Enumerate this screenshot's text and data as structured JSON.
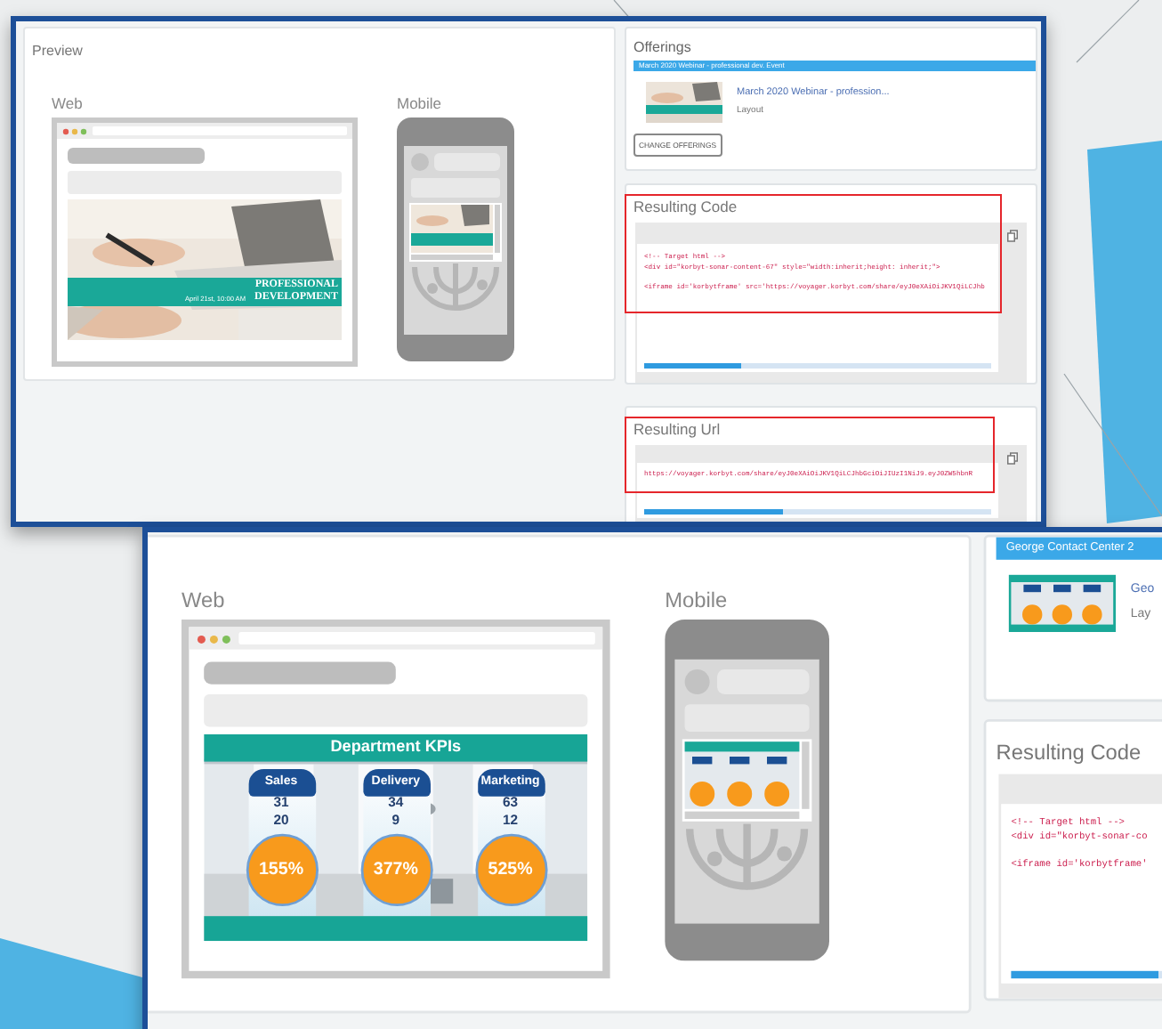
{
  "screenshots": [
    {
      "preview": {
        "title": "Preview",
        "web_label": "Web",
        "mobile_label": "Mobile",
        "web_content": {
          "kind": "banner",
          "headline": [
            "PROFESSIONAL",
            "DEVELOPMENT"
          ],
          "date": "April 21st, 10:00 AM"
        }
      },
      "offerings": {
        "title": "Offerings",
        "dropdown": "March 2020 Webinar - professional dev. Event",
        "item_title": "March 2020 Webinar - profession...",
        "item_subtitle": "Layout",
        "button": "CHANGE OFFERINGS"
      },
      "resulting_code": {
        "title": "Resulting Code",
        "highlighted": true,
        "lines": [
          "<!-- Target html -->",
          "<div id=\"korbyt-sonar-content-67\" style=\"width:inherit;height: inherit;\">",
          "<iframe id='korbytframe' src='https://voyager.korbyt.com/share/eyJ0eXAiOiJKV1QiLCJhb"
        ]
      },
      "resulting_url": {
        "title": "Resulting Url",
        "highlighted": true,
        "value": "https://voyager.korbyt.com/share/eyJ0eXAiOiJKV1QiLCJhbGciOiJIUzI1NiJ9.eyJ0ZW5hbnR"
      }
    },
    {
      "preview": {
        "web_label": "Web",
        "mobile_label": "Mobile",
        "web_content": {
          "kind": "kpi",
          "title": "Department KPIs",
          "cards": [
            {
              "name": "Sales",
              "values": [
                "31",
                "20"
              ],
              "percent": "155%"
            },
            {
              "name": "Delivery",
              "values": [
                "34",
                "9"
              ],
              "percent": "377%"
            },
            {
              "name": "Marketing",
              "values": [
                "63",
                "12"
              ],
              "percent": "525%"
            }
          ]
        }
      },
      "offerings": {
        "dropdown": "George Contact Center 2",
        "item_title": "Geo",
        "item_subtitle": "Lay"
      },
      "resulting_code": {
        "title": "Resulting Code",
        "highlighted": false,
        "lines": [
          "<!-- Target html -->",
          "<div id=\"korbyt-sonar-co",
          "<iframe id='korbytframe'"
        ]
      }
    }
  ]
}
